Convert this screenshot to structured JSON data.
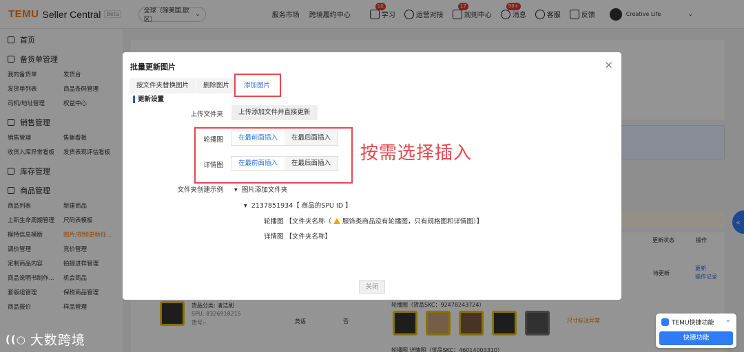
{
  "topbar": {
    "brand": "TEMU",
    "product": "Seller Central",
    "beta": "Beta",
    "region": "全球（除美国,欧区）",
    "nav": [
      "服务市场",
      "跨境履约中心"
    ],
    "tools": [
      {
        "label": "学习",
        "badge": "10",
        "icon": "book-icon"
      },
      {
        "label": "运营对接",
        "badge": "",
        "icon": "chat-icon"
      },
      {
        "label": "规则中心",
        "badge": "17",
        "icon": "rules-icon"
      },
      {
        "label": "消息",
        "badge": "99+",
        "icon": "bell-icon"
      },
      {
        "label": "客服",
        "badge": "",
        "icon": "headset-icon"
      },
      {
        "label": "反馈",
        "badge": "",
        "icon": "feedback-icon"
      }
    ],
    "account": "Creative Life"
  },
  "sidebar": {
    "home": "首页",
    "sections": [
      {
        "title": "备货单管理",
        "items": [
          "我的备货单",
          "发货台",
          "发货单列表",
          "商品条码管理",
          "司机/地址管理",
          "权益中心"
        ]
      },
      {
        "title": "销售管理",
        "items": [
          "销售管理",
          "售罄看板",
          "收货入库异常看板",
          "发货表现评估看板"
        ]
      },
      {
        "title": "库存管理",
        "items": []
      },
      {
        "title": "商品管理",
        "items": [
          "商品列表",
          "新建商品",
          "上新生命周期管理",
          "尺码表模板",
          "模特信息模版",
          "图片/视频更新任...",
          "调价管理",
          "竞价管理",
          "定制商品内容",
          "拍摄进样管理",
          "商品说明书制作...",
          "机会商品",
          "套版组管理",
          "保税商品管理",
          "商品报价",
          "样品管理"
        ]
      }
    ],
    "active_item": "图片/视频更新任..."
  },
  "background": {
    "col_update_status": "更新状态",
    "col_action": "操作",
    "status_pending": "待更新",
    "action_update": "更新",
    "action_log": "操作记录",
    "category": "货品分类: 清洁刷",
    "spu": "SPU: 8326918215",
    "sku_no": "货号:-",
    "lang": "英语",
    "no": "否",
    "carousel": "轮播图（货品SKC：92478243724）",
    "carousel2": "轮播图 详情图（货品SKC：46014003310）",
    "size_abnormal": "尺寸标注异常"
  },
  "modal": {
    "title": "批量更新图片",
    "tabs": [
      "按文件夹替换图片",
      "删除图片",
      "添加图片"
    ],
    "active_tab": 2,
    "section": "更新设置",
    "upload_label": "上传文件夹",
    "upload_button": "上传添加文件并直接更新",
    "carousel_label": "轮播图",
    "detail_label": "详情图",
    "insert_front": "在最前面插入",
    "insert_back": "在最后面插入",
    "annotation": "按需选择插入",
    "example_label": "文件夹创建示例",
    "tree_root": "图片添加文件夹",
    "tree_spu": "2137851934【 商品的SPU ID 】",
    "tree_carousel": "轮播图 【文件夹名称（",
    "tree_carousel_note": "服饰类商品没有轮播图，只有规格图和详情图）】",
    "tree_detail": "详情图 【文件夹名称】",
    "close_button": "关闭"
  },
  "quick": {
    "title": "TEMU快捷功能",
    "button": "快捷功能"
  },
  "watermark": "大数跨境"
}
